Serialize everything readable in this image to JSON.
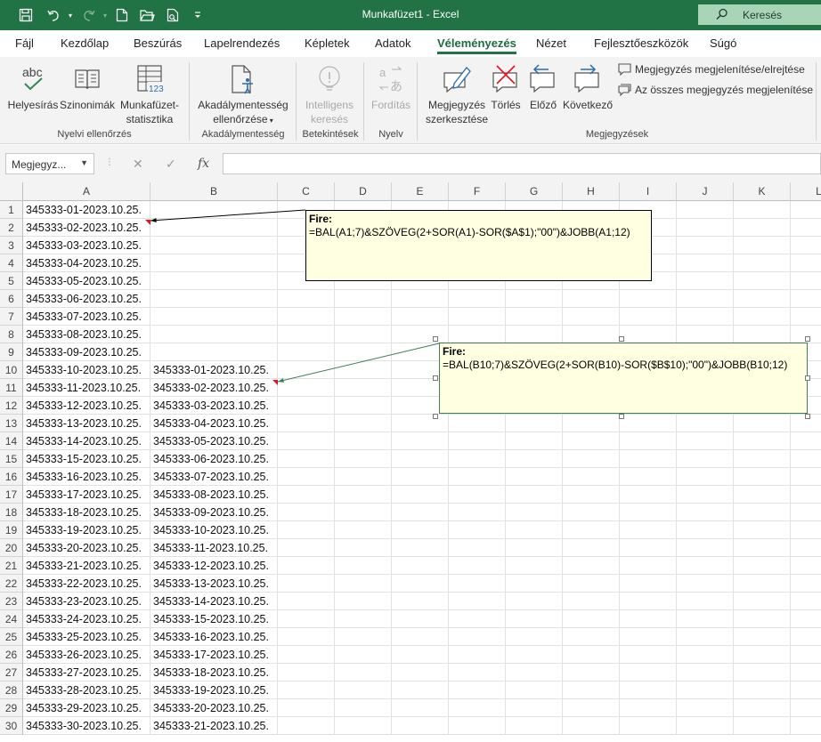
{
  "app": {
    "title": "Munkafüzet1  -  Excel",
    "search_label": "Keresés"
  },
  "tabs": [
    {
      "label": "Fájl"
    },
    {
      "label": "Kezdőlap"
    },
    {
      "label": "Beszúrás"
    },
    {
      "label": "Lapelrendezés"
    },
    {
      "label": "Képletek"
    },
    {
      "label": "Adatok"
    },
    {
      "label": "Véleményezés",
      "active": true
    },
    {
      "label": "Nézet"
    },
    {
      "label": "Fejlesztőeszközök"
    },
    {
      "label": "Súgó"
    }
  ],
  "ribbon": {
    "spelling": "Helyesírás",
    "thesaurus": "Szinonimák",
    "workbook_stats_1": "Munkafüzet-",
    "workbook_stats_2": "statisztika",
    "accessibility_1": "Akadálymentesség",
    "accessibility_2": "ellenőrzése",
    "smart_lookup_1": "Intelligens",
    "smart_lookup_2": "keresés",
    "translate": "Fordítás",
    "edit_comment_1": "Megjegyzés",
    "edit_comment_2": "szerkesztése",
    "delete": "Törlés",
    "previous": "Előző",
    "next": "Következő",
    "show_hide_comment": "Megjegyzés megjelenítése/elrejtése",
    "show_all_comments": "Az összes megjegyzés megjelenítése",
    "groups": {
      "proofing": "Nyelvi ellenőrzés",
      "accessibility": "Akadálymentesség",
      "insights": "Betekintések",
      "language": "Nyelv",
      "comments": "Megjegyzések"
    },
    "abc_text": "abc",
    "stats_badge": "123"
  },
  "formula_bar": {
    "name_box": "Megjegyz...",
    "fx_label": "fx",
    "formula": ""
  },
  "grid": {
    "columns": [
      "A",
      "B",
      "C",
      "D",
      "E",
      "F",
      "G",
      "H",
      "I",
      "J",
      "K",
      "L"
    ],
    "rows": [
      "1",
      "2",
      "3",
      "4",
      "5",
      "6",
      "7",
      "8",
      "9",
      "10",
      "11",
      "12",
      "13",
      "14",
      "15",
      "16",
      "17",
      "18",
      "19",
      "20",
      "21",
      "22",
      "23",
      "24",
      "25",
      "26",
      "27",
      "28",
      "29",
      "30"
    ],
    "col_a": [
      "345333-01-2023.10.25.",
      "345333-02-2023.10.25.",
      "345333-03-2023.10.25.",
      "345333-04-2023.10.25.",
      "345333-05-2023.10.25.",
      "345333-06-2023.10.25.",
      "345333-07-2023.10.25.",
      "345333-08-2023.10.25.",
      "345333-09-2023.10.25.",
      "345333-10-2023.10.25.",
      "345333-11-2023.10.25.",
      "345333-12-2023.10.25.",
      "345333-13-2023.10.25.",
      "345333-14-2023.10.25.",
      "345333-15-2023.10.25.",
      "345333-16-2023.10.25.",
      "345333-17-2023.10.25.",
      "345333-18-2023.10.25.",
      "345333-19-2023.10.25.",
      "345333-20-2023.10.25.",
      "345333-21-2023.10.25.",
      "345333-22-2023.10.25.",
      "345333-23-2023.10.25.",
      "345333-24-2023.10.25.",
      "345333-25-2023.10.25.",
      "345333-26-2023.10.25.",
      "345333-27-2023.10.25.",
      "345333-28-2023.10.25.",
      "345333-29-2023.10.25.",
      "345333-30-2023.10.25."
    ],
    "col_b": [
      "",
      "",
      "",
      "",
      "",
      "",
      "",
      "",
      "",
      "345333-01-2023.10.25.",
      "345333-02-2023.10.25.",
      "345333-03-2023.10.25.",
      "345333-04-2023.10.25.",
      "345333-05-2023.10.25.",
      "345333-06-2023.10.25.",
      "345333-07-2023.10.25.",
      "345333-08-2023.10.25.",
      "345333-09-2023.10.25.",
      "345333-10-2023.10.25.",
      "345333-11-2023.10.25.",
      "345333-12-2023.10.25.",
      "345333-13-2023.10.25.",
      "345333-14-2023.10.25.",
      "345333-15-2023.10.25.",
      "345333-16-2023.10.25.",
      "345333-17-2023.10.25.",
      "345333-18-2023.10.25.",
      "345333-19-2023.10.25.",
      "345333-20-2023.10.25.",
      "345333-21-2023.10.25."
    ]
  },
  "comments": [
    {
      "author": "Fire:",
      "text": "=BAL(A1;7)&SZÖVEG(2+SOR(A1)-SOR($A$1);\"00\")&JOBB(A1;12)"
    },
    {
      "author": "Fire:",
      "text": "=BAL(B10;7)&SZÖVEG(2+SOR(B10)-SOR($B$10);\"00\")&JOBB(B10;12)"
    }
  ],
  "colors": {
    "excel_green": "#217346",
    "comment_bg": "#ffffe1",
    "comment_indicator": "#e81123"
  }
}
